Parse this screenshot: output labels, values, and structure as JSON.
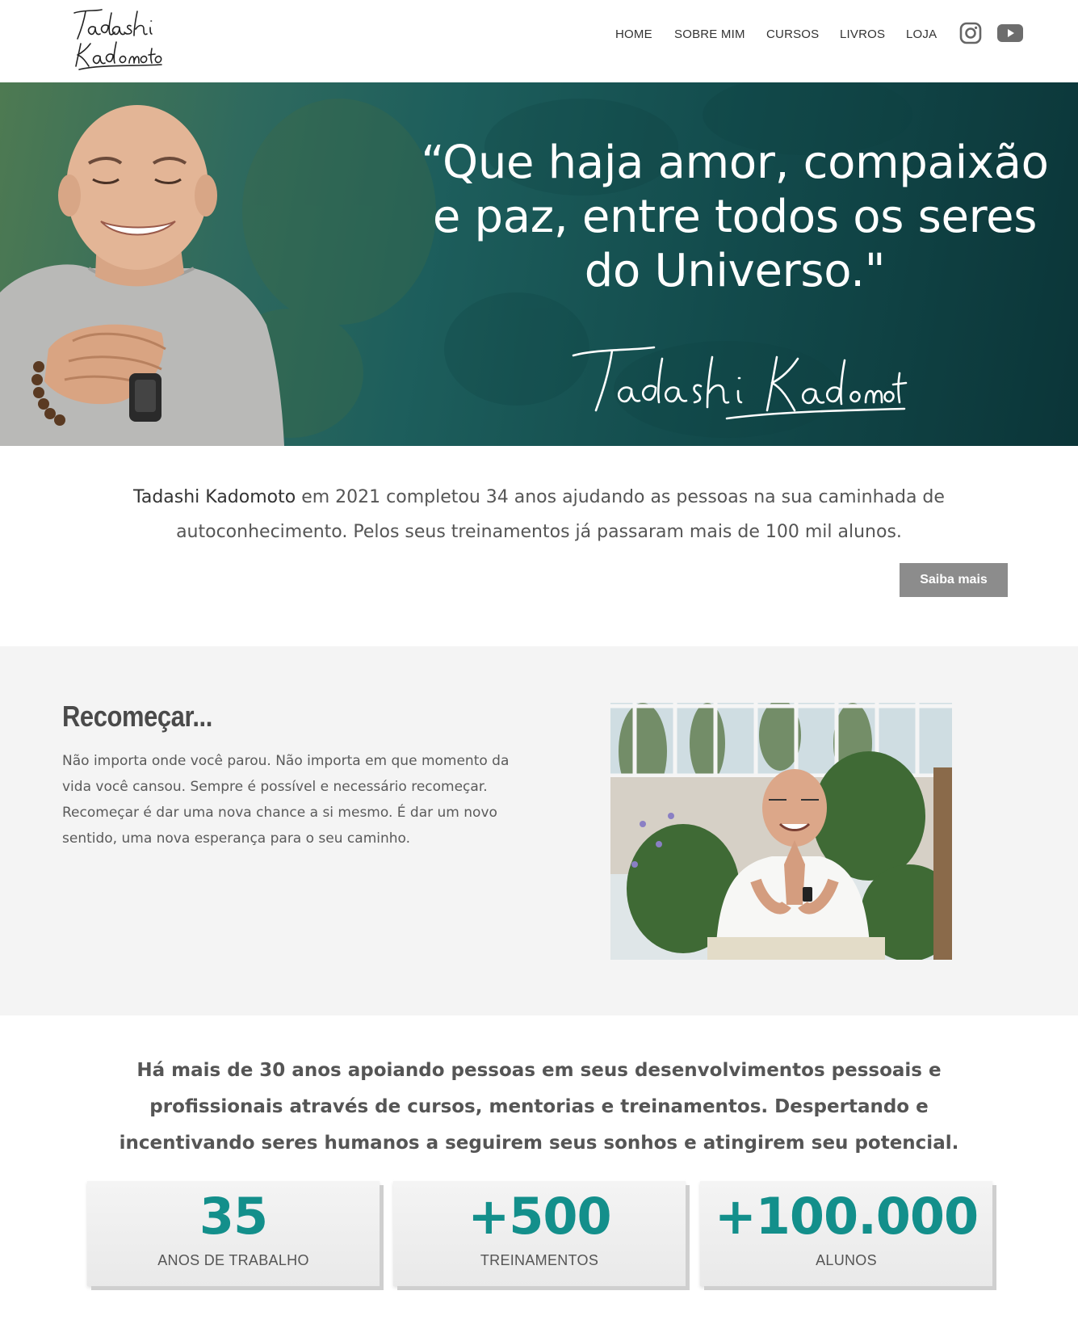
{
  "header": {
    "logo_text": "Tadashi Kadomoto",
    "nav": [
      "HOME",
      "SOBRE MIM",
      "CURSOS",
      "LIVROS",
      "LOJA"
    ],
    "social_icons": [
      "instagram-icon",
      "youtube-icon"
    ]
  },
  "hero": {
    "quote_lines": [
      "“Que haja amor, compaixão",
      "e paz, entre todos os seres",
      "do Universo.\""
    ],
    "signature": "Tadashi Kadomoto"
  },
  "intro": {
    "name": "Tadashi Kadomoto",
    "text": " em 2021 completou 34 anos ajudando as pessoas na sua caminhada de autoconhecimento. Pelos seus treinamentos já passaram mais de 100 mil alunos.",
    "button": "Saiba mais"
  },
  "recomecar": {
    "title": "Recomeçar...",
    "text": "Não importa onde você parou. Não importa em que momento da vida você cansou. Sempre é possível e necessário recomeçar. Recomeçar é dar uma nova chance a si mesmo. É dar um novo sentido, uma nova esperança para o seu caminho."
  },
  "stats": {
    "text": "Há mais de 30 anos apoiando pessoas em seus desenvolvimentos pessoais e profissionais através de cursos, mentorias e treinamentos. Despertando e incentivando seres humanos a seguirem seus sonhos e atingirem seu potencial.",
    "cards": [
      {
        "value": "35",
        "label": "ANOS DE TRABALHO"
      },
      {
        "value": "+500",
        "label": "TREINAMENTOS"
      },
      {
        "value": "+100.000",
        "label": "ALUNOS"
      }
    ]
  },
  "colors": {
    "accent": "#138f8b",
    "hero_dark": "#0b3538",
    "button_gray": "#8c8c8c",
    "section_gray": "#f4f4f4"
  }
}
